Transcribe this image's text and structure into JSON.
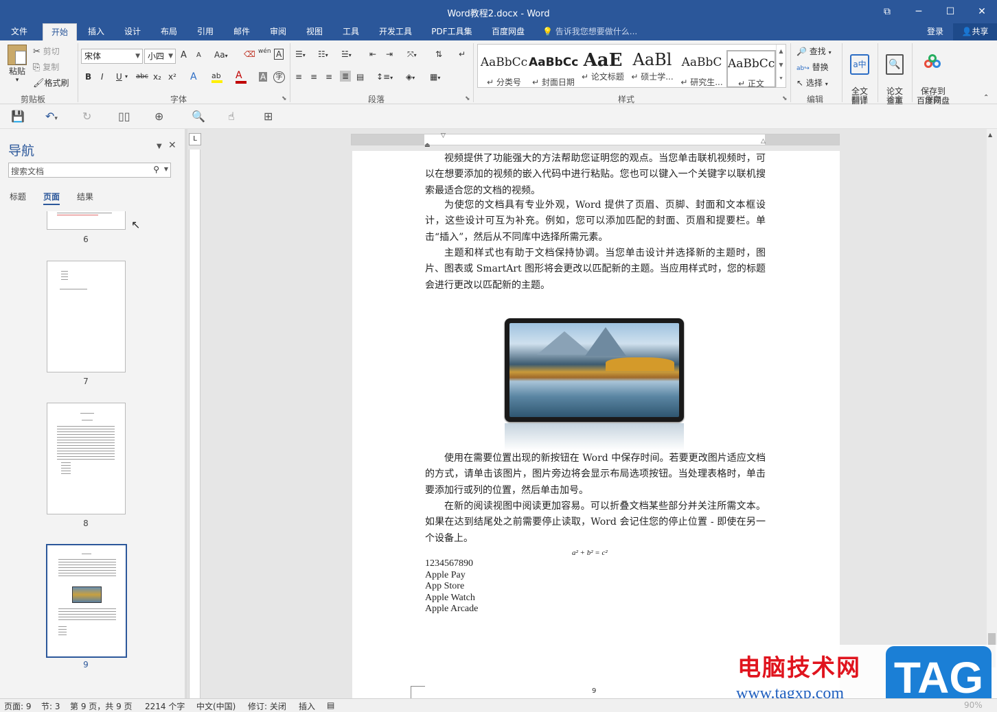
{
  "window": {
    "title": "Word教程2.docx - Word",
    "restore_icon": "ribbon-display-icon",
    "minimize": "─",
    "maximize": "☐",
    "close": "✕"
  },
  "tabs": [
    {
      "label": "文件"
    },
    {
      "label": "开始"
    },
    {
      "label": "插入"
    },
    {
      "label": "设计"
    },
    {
      "label": "布局"
    },
    {
      "label": "引用"
    },
    {
      "label": "邮件"
    },
    {
      "label": "审阅"
    },
    {
      "label": "视图"
    },
    {
      "label": "工具"
    },
    {
      "label": "开发工具"
    },
    {
      "label": "PDF工具集"
    },
    {
      "label": "百度网盘"
    }
  ],
  "tell_me": "告诉我您想要做什么...",
  "login": "登录",
  "share": "共享",
  "ribbon": {
    "clipboard": {
      "paste": "粘贴",
      "cut": "剪切",
      "copy": "复制",
      "format_painter": "格式刷",
      "label": "剪贴板"
    },
    "font": {
      "name": "宋体",
      "size": "小四",
      "label": "字体",
      "case": "Aa",
      "grow": "A",
      "shrink": "A",
      "bold": "B",
      "italic": "I",
      "underline": "U",
      "strike": "abc",
      "sub": "x₂",
      "sup": "x²",
      "phonetic": "wén",
      "border_char": "A",
      "font_color": "A",
      "highlight": "ab",
      "shade": "A",
      "circle": "字"
    },
    "paragraph": {
      "label": "段落"
    },
    "styles": {
      "label": "样式",
      "items": [
        {
          "sample": "AaBbCc",
          "name": "分类号"
        },
        {
          "sample": "AaBbCc",
          "name": "封面日期"
        },
        {
          "sample": "AaE",
          "name": "论文标题"
        },
        {
          "sample": "AaBl",
          "name": "硕士学..."
        },
        {
          "sample": "AaBbC",
          "name": "研究生..."
        },
        {
          "sample": "AaBbCcI",
          "name": "正文"
        }
      ]
    },
    "editing": {
      "find": "查找",
      "replace": "替换",
      "select": "选择",
      "label": "编辑"
    },
    "translate": {
      "btn": "全文\n翻译",
      "label": "翻译"
    },
    "paper": {
      "btn": "论文\n查重",
      "label": "论文"
    },
    "save": {
      "btn": "保存到\n百度网盘",
      "label": "保存"
    }
  },
  "nav": {
    "title": "导航",
    "search_placeholder": "搜索文档",
    "tabs": [
      "标题",
      "页面",
      "结果"
    ],
    "pages": [
      "6",
      "7",
      "8",
      "9"
    ]
  },
  "document": {
    "paragraphs": [
      "视频提供了功能强大的方法帮助您证明您的观点。当您单击联机视频时，可以在想要添加的视频的嵌入代码中进行粘贴。您也可以键入一个关键字以联机搜索最适合您的文档的视频。",
      "为使您的文档具有专业外观，Word 提供了页眉、页脚、封面和文本框设计，这些设计可互为补充。例如，您可以添加匹配的封面、页眉和提要栏。单击“插入”，然后从不同库中选择所需元素。",
      "主题和样式也有助于文档保持协调。当您单击设计并选择新的主题时，图片、图表或 SmartArt 图形将会更改以匹配新的主题。当应用样式时，您的标题会进行更改以匹配新的主题。",
      "使用在需要位置出现的新按钮在 Word 中保存时间。若要更改图片适应文档的方式，请单击该图片，图片旁边将会显示布局选项按钮。当处理表格时，单击要添加行或列的位置，然后单击加号。",
      "在新的阅读视图中阅读更加容易。可以折叠文档某些部分并关注所需文本。如果在达到结尾处之前需要停止读取，Word 会记住您的停止位置 - 即使在另一个设备上。"
    ],
    "equation": "a² + b² = c²",
    "lines": [
      "1234567890",
      "Apple Pay",
      "App Store",
      "Apple Watch",
      "Apple Arcade"
    ],
    "page_number": "9"
  },
  "watermark": {
    "text": "电脑技术网",
    "url": "www.tagxp.com",
    "tag": "TAG"
  },
  "status": {
    "page": "页面: 9",
    "section": "节: 3",
    "page_of": "第 9 页，共 9 页",
    "words": "2214 个字",
    "lang": "中文(中国)",
    "revision": "修订: 关闭",
    "insert": "插入",
    "zoom": "90%"
  }
}
